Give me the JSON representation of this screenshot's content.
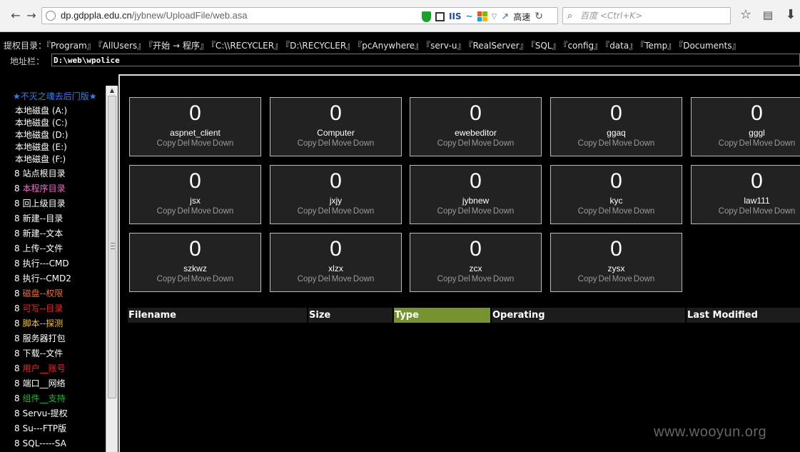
{
  "browser": {
    "url_domain": "dp.gdppla.edu.cn",
    "url_path": "/jybnew/UploadFile/web.asa",
    "iis_label": "IIS",
    "speed_label": "高速",
    "search_placeholder": "百度 <Ctrl+K>"
  },
  "priv": {
    "label": "提权目录：",
    "links": [
      "『Program』",
      "『AllUsers』",
      "『开始 → 程序』",
      "『C:\\\\RECYCLER』",
      "『D:\\RECYCLER』",
      "『pcAnywhere』",
      "『serv-u』",
      "『RealServer』",
      "『SQL』",
      "『config』",
      "『data』",
      "『Temp』",
      "『Documents』"
    ]
  },
  "address": {
    "label": "地址栏：",
    "value": "D:\\web\\wpolice"
  },
  "left": {
    "title": "★不灭之魂去后门版★",
    "disks": [
      "本地磁盘 (A:)",
      "本地磁盘 (C:)",
      "本地磁盘 (D:)",
      "本地磁盘 (E:)",
      "本地磁盘 (F:)"
    ],
    "menu": [
      {
        "num": "8",
        "text": "站点根目录",
        "color": ""
      },
      {
        "num": "8",
        "text": "本程序目录",
        "color": "pink"
      },
      {
        "num": "8",
        "text": "回上级目录",
        "color": ""
      },
      {
        "num": "8",
        "text": "新建--目录",
        "color": ""
      },
      {
        "num": "8",
        "text": "新建--文本",
        "color": ""
      },
      {
        "num": "8",
        "text": "上传--文件",
        "color": ""
      },
      {
        "num": "8",
        "text": "执行---CMD",
        "color": ""
      },
      {
        "num": "8",
        "text": "执行--CMD2",
        "color": ""
      },
      {
        "num": "8",
        "text": "磁盘--权限",
        "color": "orange"
      },
      {
        "num": "8",
        "text": "可写--目录",
        "color": "red"
      },
      {
        "num": "8",
        "text": "脚本--探测",
        "color": "yellow"
      },
      {
        "num": "8",
        "text": "服务器打包",
        "color": ""
      },
      {
        "num": "8",
        "text": "下载--文件",
        "color": ""
      },
      {
        "num": "8",
        "text": "用户__账号",
        "color": "red"
      },
      {
        "num": "8",
        "text": "端口__网络",
        "color": ""
      },
      {
        "num": "8",
        "text": "组件__支持",
        "color": "green"
      },
      {
        "num": "8",
        "text": "Servu-提权",
        "color": ""
      },
      {
        "num": "8",
        "text": "Su---FTP版",
        "color": ""
      },
      {
        "num": "8",
        "text": "SQL-----SA",
        "color": ""
      }
    ]
  },
  "folders": [
    {
      "count": "0",
      "name": "aspnet_client"
    },
    {
      "count": "0",
      "name": "Computer"
    },
    {
      "count": "0",
      "name": "ewebeditor"
    },
    {
      "count": "0",
      "name": "ggaq"
    },
    {
      "count": "0",
      "name": "gggl"
    },
    {
      "count": "0",
      "name": "jsx"
    },
    {
      "count": "0",
      "name": "jxjy"
    },
    {
      "count": "0",
      "name": "jybnew"
    },
    {
      "count": "0",
      "name": "kyc"
    },
    {
      "count": "0",
      "name": "law111"
    },
    {
      "count": "0",
      "name": "szkwz"
    },
    {
      "count": "0",
      "name": "xlzx"
    },
    {
      "count": "0",
      "name": "zcx"
    },
    {
      "count": "0",
      "name": "zysx"
    }
  ],
  "ops": {
    "copy": "Copy",
    "del": "Del",
    "move": "Move",
    "down": "Down"
  },
  "table": {
    "columns": [
      "Filename",
      "Size",
      "Type",
      "Operating",
      "Last Modified"
    ],
    "active_column": "Type"
  },
  "colors": {
    "accent_title": "#3b7de8",
    "active_column": "#76932f",
    "card_bg": "#222222"
  },
  "watermark": "www.wooyun.org"
}
